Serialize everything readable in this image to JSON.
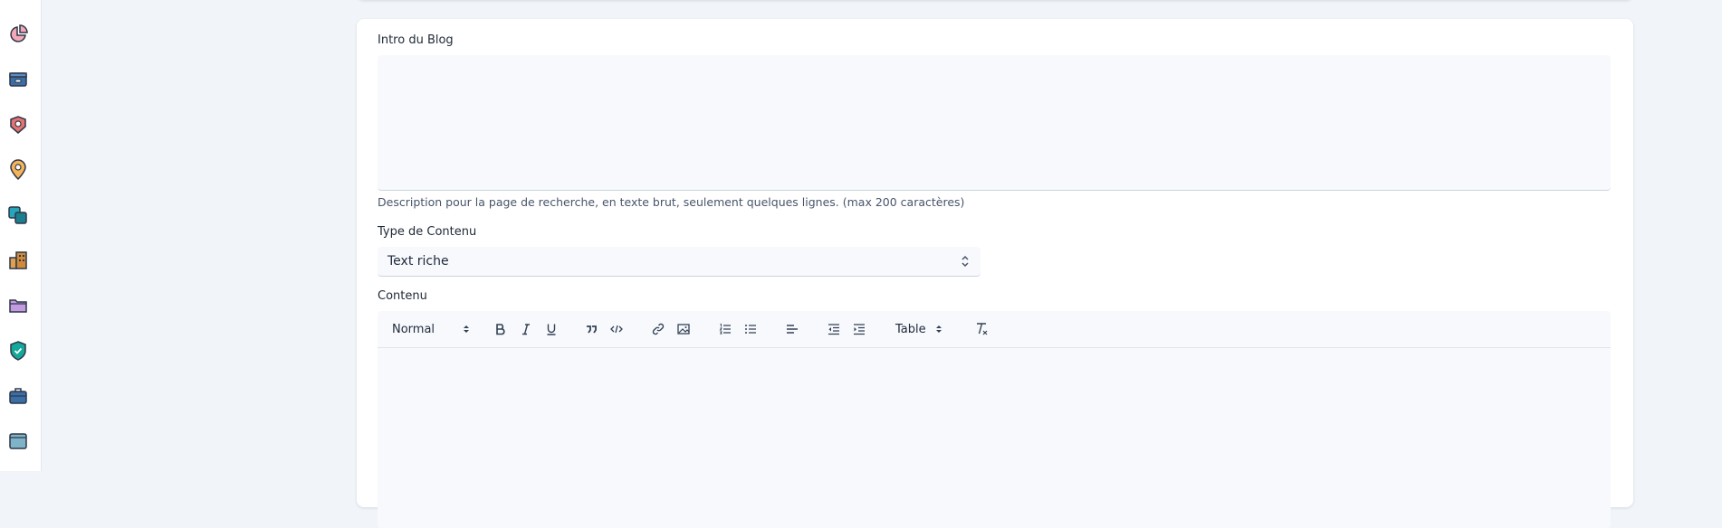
{
  "sidebar": {
    "icons": [
      "pie-chart-icon",
      "archive-box-icon",
      "tag-icon",
      "map-pin-icon",
      "duplicate-icon",
      "building-icon",
      "folder-icon",
      "shield-check-icon",
      "briefcase-icon",
      "window-icon"
    ]
  },
  "form": {
    "intro": {
      "label": "Intro du Blog",
      "value": "",
      "help": "Description pour la page de recherche, en texte brut, seulement quelques lignes. (max 200 caractères)"
    },
    "content_type": {
      "label": "Type de Contenu",
      "selected": "Text riche"
    },
    "content": {
      "label": "Contenu",
      "toolbar": {
        "heading_select": "Normal",
        "table_select": "Table"
      }
    }
  }
}
